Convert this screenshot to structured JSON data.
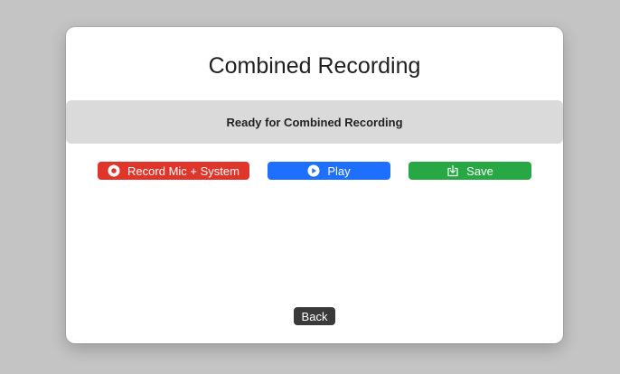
{
  "dialog": {
    "title": "Combined Recording",
    "status": "Ready for Combined Recording"
  },
  "buttons": {
    "record": {
      "label": "Record Mic + System",
      "icon": "record-icon",
      "color": "#e0352b"
    },
    "play": {
      "label": "Play",
      "icon": "play-icon",
      "color": "#1f6fff"
    },
    "save": {
      "label": "Save",
      "icon": "save-icon",
      "color": "#27a844"
    },
    "back": {
      "label": "Back",
      "color": "#3a3a3a"
    }
  }
}
